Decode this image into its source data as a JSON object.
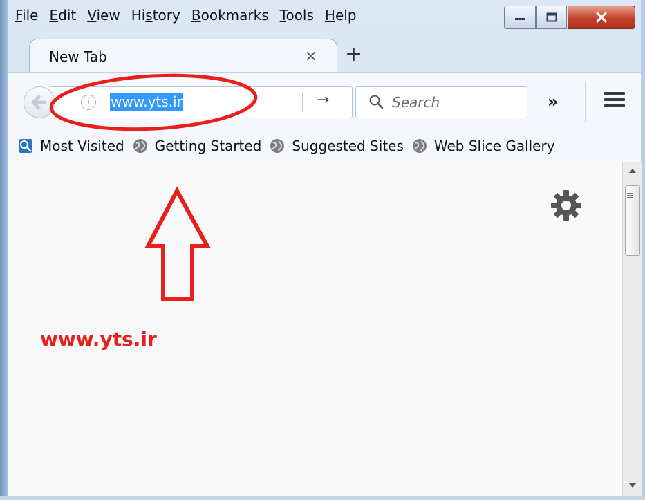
{
  "menubar": {
    "items": [
      {
        "label": "File",
        "accel": "F",
        "rest": "ile"
      },
      {
        "label": "Edit",
        "accel": "E",
        "rest": "dit"
      },
      {
        "label": "View",
        "accel": "V",
        "rest": "iew"
      },
      {
        "label": "History",
        "pre": "Hi",
        "accel": "s",
        "rest": "tory"
      },
      {
        "label": "Bookmarks",
        "accel": "B",
        "rest": "ookmarks"
      },
      {
        "label": "Tools",
        "accel": "T",
        "rest": "ools"
      },
      {
        "label": "Help",
        "accel": "H",
        "rest": "elp"
      }
    ]
  },
  "tab": {
    "title": "New Tab",
    "close_glyph": "×",
    "new_tab_glyph": "+"
  },
  "navbar": {
    "url": "www.yts.ir",
    "go_glyph": "→",
    "search_placeholder": "Search",
    "overflow_glyph": "»"
  },
  "bookmarks": [
    {
      "label": "Most Visited",
      "icon": "most-visited-icon"
    },
    {
      "label": "Getting Started",
      "icon": "globe-icon"
    },
    {
      "label": "Suggested Sites",
      "icon": "globe-icon"
    },
    {
      "label": "Web Slice Gallery",
      "icon": "globe-icon"
    }
  ],
  "annotation": {
    "text": "www.yts.ir",
    "color": "#e8201c"
  },
  "colors": {
    "selection": "#3399ff",
    "close_button": "#c2412a"
  }
}
